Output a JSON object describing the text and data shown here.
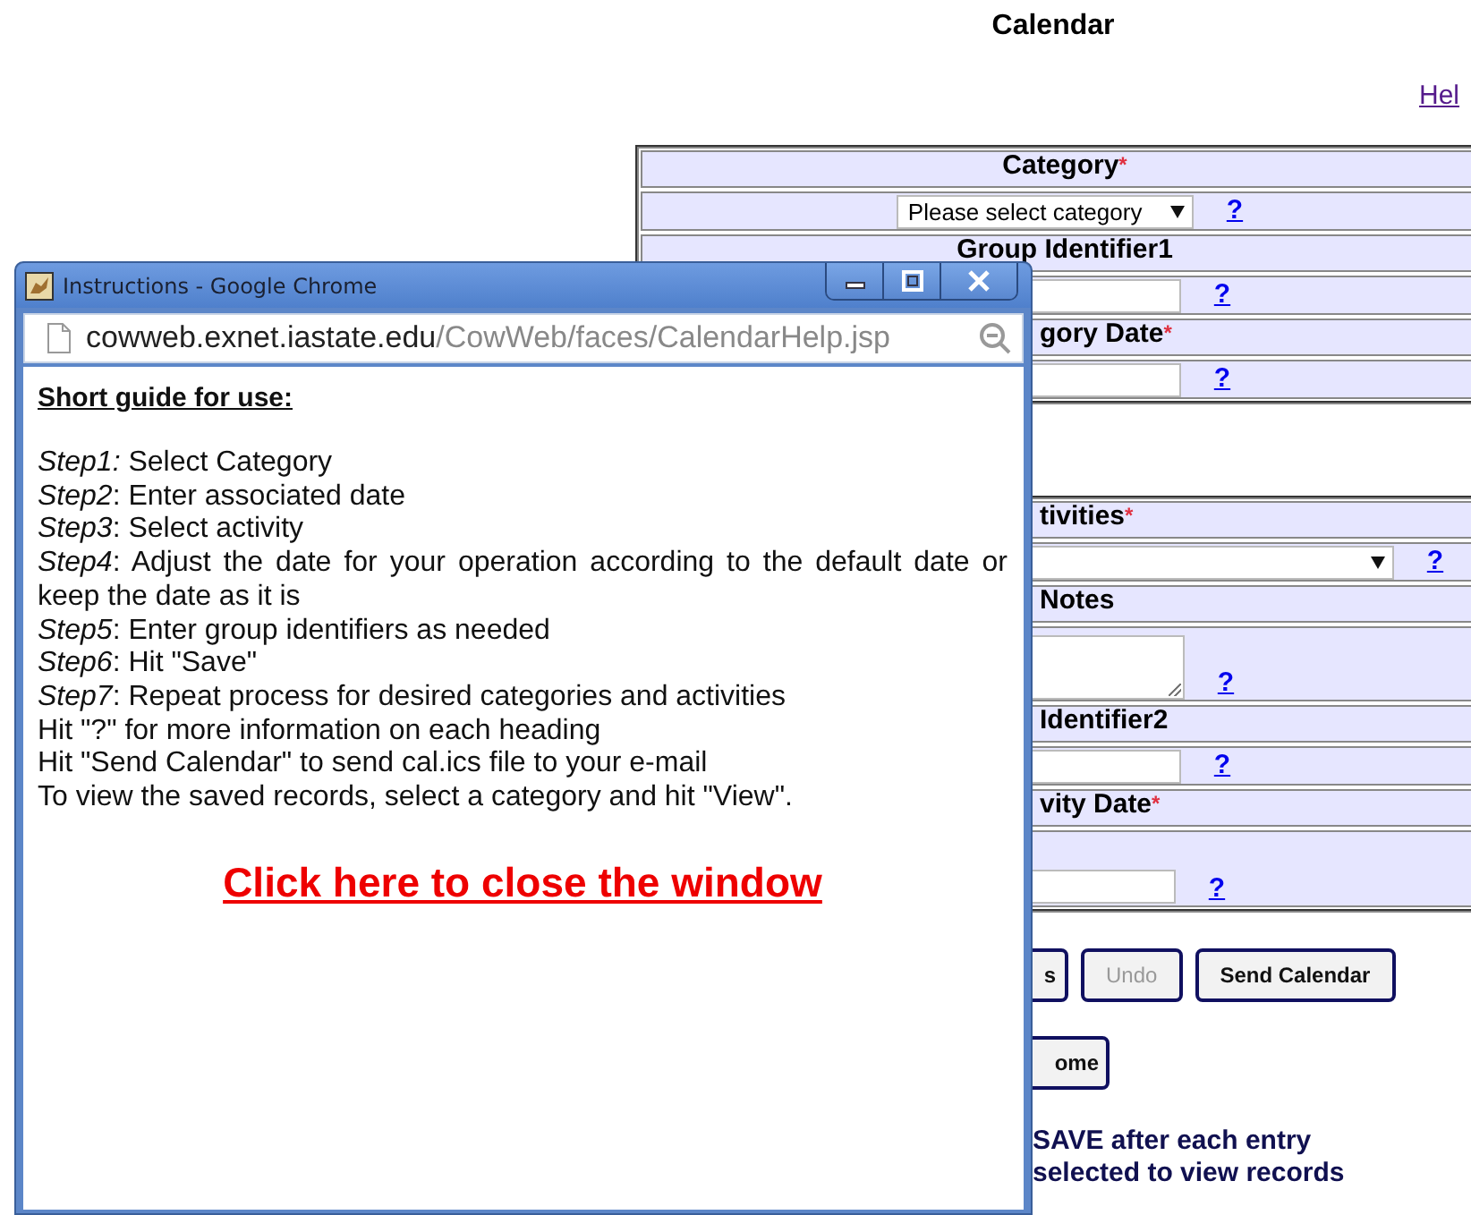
{
  "page": {
    "title": "Calendar",
    "help_link": "Hel"
  },
  "sections": [
    [
      {
        "kind": "select",
        "label": "Category",
        "mark": "*",
        "value": "Please select category",
        "help": "?"
      },
      {
        "kind": "input",
        "label": "Group Identifier1",
        "help": "?"
      },
      {
        "kind": "input",
        "label": "gory Date",
        "mark": "*",
        "help": "?"
      }
    ],
    [
      {
        "kind": "wide-select",
        "label": "tivities",
        "mark": "*",
        "help": "?"
      },
      {
        "kind": "textarea",
        "label": "Notes",
        "help": "?"
      },
      {
        "kind": "input",
        "label": "Identifier2",
        "help": "?"
      },
      {
        "kind": "tall-input",
        "label": "vity Date",
        "mark": "*",
        "help": "?"
      }
    ]
  ],
  "buttons": [
    {
      "label": "s",
      "disabled": false
    },
    {
      "label": "Undo",
      "disabled": true
    },
    {
      "label": "Send Calendar",
      "disabled": false
    }
  ],
  "buttons_row2": [
    {
      "label": "ome",
      "disabled": false
    }
  ],
  "notes": [
    "SAVE after each entry",
    "selected to view records"
  ],
  "popup": {
    "title": "Instructions - Google Chrome",
    "url_host": "cowweb.exnet.iastate.edu",
    "url_path": "/CowWeb/faces/CalendarHelp.jsp",
    "heading": "Short guide for use:",
    "lines": [
      "*Step1:* Select Category",
      "*Step2*: Enter associated date",
      "*Step3*: Select activity",
      "*Step4*: Adjust the date for your operation according to the default date or keep the date as it is",
      "*Step5*: Enter group identifiers as needed",
      "*Step6*: Hit \"Save\"",
      "*Step7*: Repeat process for desired categories and activities",
      "Hit \"?\" for more information on each heading",
      "Hit \"Send Calendar\" to send cal.ics file to your e-mail",
      "To view the saved records, select a category and hit \"View\"."
    ],
    "close_link": "Click here to close the window"
  }
}
